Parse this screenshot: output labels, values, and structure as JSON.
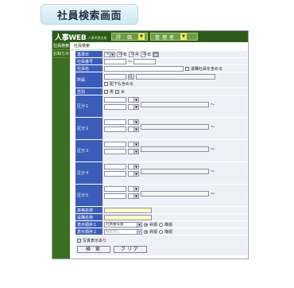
{
  "page_title": "社員検索画面",
  "logo": {
    "main": "人事WEB",
    "sub": "人事考課支援"
  },
  "top_menu": [
    {
      "label": "評 価",
      "dropdown": "▼"
    },
    {
      "label": "管理者",
      "dropdown": "▼"
    }
  ],
  "sidebar": {
    "items": [
      "社員検索",
      "お知らせ"
    ]
  },
  "tab_title": "社員検索",
  "fields": {
    "base_date": {
      "label": "基準日",
      "era": "平成",
      "year": "26",
      "year_unit": "年",
      "month": "10",
      "month_unit": "月",
      "day": "31",
      "day_unit": "日"
    },
    "employee_no": {
      "label": "社員番号",
      "separator": "〜"
    },
    "employee_name": {
      "label": "社員名",
      "option": "退職社員を含める"
    },
    "department": {
      "label": "所属",
      "option": "配下も含める"
    },
    "gender": {
      "label": "性別",
      "male": "男",
      "female": "女"
    },
    "kubun": [
      {
        "label": "区分１"
      },
      {
        "label": "区分２"
      },
      {
        "label": "区分３"
      },
      {
        "label": "区分４"
      },
      {
        "label": "区分５"
      }
    ],
    "kubun_separator": "〜",
    "qualification_name": {
      "label": "資格名称"
    },
    "position_name": {
      "label": "役職名称"
    },
    "sort1": {
      "label": "表示順序１",
      "value": "社員番号順",
      "asc": "昇順",
      "desc": "降順"
    },
    "sort2": {
      "label": "表示順序２",
      "value": "指定なし",
      "asc": "昇順",
      "desc": "降順"
    },
    "show_photo": {
      "label": "写真表示あり"
    }
  },
  "buttons": {
    "search": "検 索",
    "clear": "クリア"
  },
  "calendar_icon": "calendar-icon",
  "dropdown_arrow": "▼"
}
